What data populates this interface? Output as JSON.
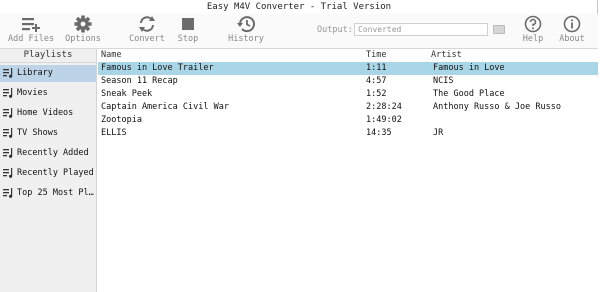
{
  "window": {
    "title": "Easy M4V Converter - Trial Version"
  },
  "toolbar": {
    "buttons": [
      {
        "label": "Add Files",
        "icon": "add-files-icon"
      },
      {
        "label": "Options",
        "icon": "gear-icon"
      },
      {
        "label": "Convert",
        "icon": "convert-icon"
      },
      {
        "label": "Stop",
        "icon": "stop-icon"
      },
      {
        "label": "History",
        "icon": "history-icon"
      },
      {
        "label": "Help",
        "icon": "help-icon"
      },
      {
        "label": "About",
        "icon": "info-icon"
      }
    ],
    "output_label": "Output:",
    "output_value": "Converted"
  },
  "sidebar": {
    "header": "Playlists",
    "items": [
      {
        "label": "Library",
        "icon": "playlist-icon",
        "selected": true
      },
      {
        "label": "Movies",
        "icon": "playlist-icon"
      },
      {
        "label": "Home Videos",
        "icon": "playlist-icon"
      },
      {
        "label": "TV Shows",
        "icon": "playlist-icon"
      },
      {
        "label": "Recently Added",
        "icon": "playlist-icon"
      },
      {
        "label": "Recently Played",
        "icon": "playlist-icon"
      },
      {
        "label": "Top 25 Most Pl…",
        "icon": "playlist-icon"
      }
    ]
  },
  "table": {
    "columns": [
      "Name",
      "Time",
      "Artist"
    ],
    "rows": [
      {
        "name": "Famous in Love  Trailer",
        "time": "1:11",
        "artist": "Famous in Love",
        "selected": true
      },
      {
        "name": "Season 11 Recap",
        "time": "4:57",
        "artist": "NCIS"
      },
      {
        "name": "Sneak Peek",
        "time": "1:52",
        "artist": "The Good Place"
      },
      {
        "name": "Captain America  Civil War",
        "time": "2:28:24",
        "artist": "Anthony Russo & Joe Russo"
      },
      {
        "name": "Zootopia",
        "time": "1:49:02",
        "artist": ""
      },
      {
        "name": "ELLIS",
        "time": "14:35",
        "artist": "JR"
      }
    ]
  },
  "colors": {
    "selected_row": "#a9d6e6",
    "selected_sidebar": "#bcd3e8",
    "icon": "#6b6b6b"
  }
}
